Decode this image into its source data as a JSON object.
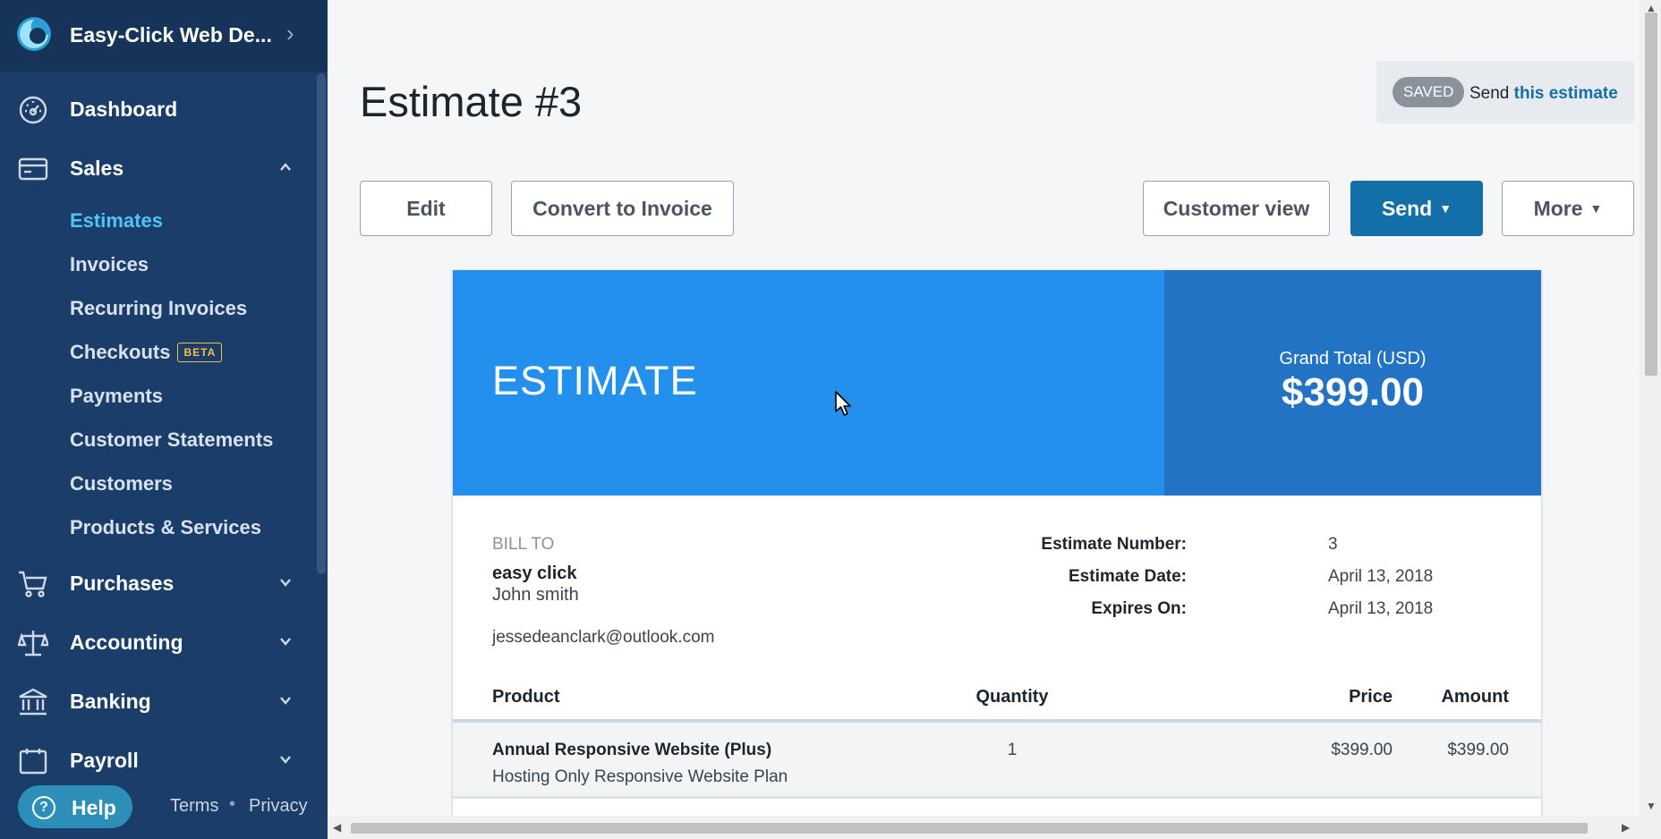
{
  "sidebar": {
    "company": "Easy-Click Web De...",
    "nav": {
      "dashboard": "Dashboard",
      "sales": "Sales",
      "purchases": "Purchases",
      "accounting": "Accounting",
      "banking": "Banking",
      "payroll": "Payroll"
    },
    "sales_items": {
      "estimates": "Estimates",
      "invoices": "Invoices",
      "recurring": "Recurring Invoices",
      "checkouts": "Checkouts",
      "checkouts_badge": "BETA",
      "payments": "Payments",
      "statements": "Customer Statements",
      "customers": "Customers",
      "products": "Products & Services"
    },
    "footer": {
      "help": "Help",
      "terms": "Terms",
      "separator": "•",
      "privacy": "Privacy"
    }
  },
  "header": {
    "title": "Estimate #3",
    "status_badge": "SAVED",
    "status_send": "Send",
    "status_link": "this estimate"
  },
  "toolbar": {
    "edit": "Edit",
    "convert": "Convert to Invoice",
    "customer_view": "Customer view",
    "send": "Send",
    "more": "More"
  },
  "document": {
    "heading": "ESTIMATE",
    "grand_total_label": "Grand Total (USD)",
    "grand_total_value": "$399.00",
    "bill_to_label": "BILL TO",
    "customer_name": "easy click",
    "contact_name": "John smith",
    "email": "jessedeanclark@outlook.com",
    "meta": {
      "number_label": "Estimate Number:",
      "number_value": "3",
      "date_label": "Estimate Date:",
      "date_value": "April 13, 2018",
      "expires_label": "Expires On:",
      "expires_value": "April 13, 2018"
    },
    "columns": {
      "product": "Product",
      "quantity": "Quantity",
      "price": "Price",
      "amount": "Amount"
    },
    "items": [
      {
        "name": "Annual Responsive Website (Plus)",
        "description": "Hosting Only Responsive Website Plan",
        "quantity": "1",
        "price": "$399.00",
        "amount": "$399.00"
      }
    ]
  },
  "colors": {
    "sidebar_bg": "#1b3d6a",
    "accent_active": "#4ec3f5",
    "primary_button": "#136fa8",
    "doc_header_left": "#2490ee",
    "doc_header_right": "#2273c4"
  },
  "icons": [
    "logo-icon",
    "dashboard-icon",
    "sales-icon",
    "purchases-icon",
    "accounting-icon",
    "banking-icon",
    "payroll-icon",
    "help-icon",
    "chevron-right-icon",
    "chevron-up-icon",
    "chevron-down-icon",
    "caret-down-icon",
    "mouse-cursor-icon"
  ]
}
